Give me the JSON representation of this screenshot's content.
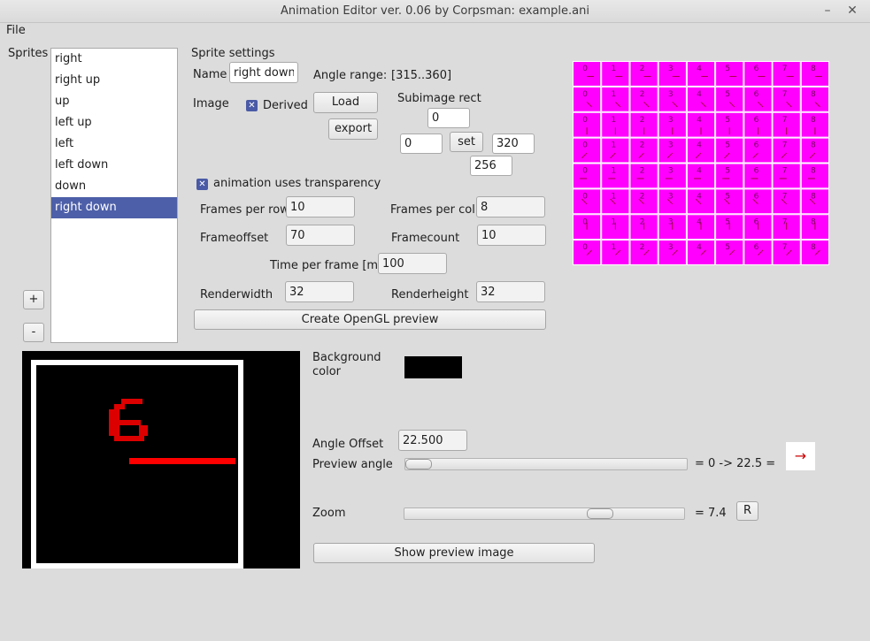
{
  "window": {
    "title": "Animation Editor ver. 0.06 by Corpsman: example.ani",
    "minimize": "–",
    "close": "✕"
  },
  "menu": {
    "file": "File"
  },
  "sprites": {
    "label": "Sprites",
    "items": [
      "right",
      "right up",
      "up",
      "left up",
      "left",
      "left down",
      "down",
      "right down"
    ],
    "selected_index": 7,
    "add_label": "+",
    "remove_label": "-"
  },
  "settings": {
    "heading": "Sprite settings",
    "name_label": "Name",
    "name_value": "right down",
    "angle_range_label": "Angle range:",
    "angle_range_value": "[315..360]",
    "image_label": "Image",
    "derived_label": "Derived",
    "derived_checked": true,
    "load_label": "Load",
    "export_label": "export",
    "subimage_label": "Subimage rect",
    "sub_top": "0",
    "sub_left": "0",
    "sub_set": "set",
    "sub_right": "320",
    "sub_bottom": "256",
    "transparency_label": "animation uses transparency",
    "transparency_checked": true,
    "frames_per_row_label": "Frames per row",
    "frames_per_row": "10",
    "frames_per_col_label": "Frames per col",
    "frames_per_col": "8",
    "frameoffset_label": "Frameoffset",
    "frameoffset": "70",
    "framecount_label": "Framecount",
    "framecount": "10",
    "time_per_frame_label": "Time per frame [ms]",
    "time_per_frame": "100",
    "renderwidth_label": "Renderwidth",
    "renderwidth": "32",
    "renderheight_label": "Renderheight",
    "renderheight": "32",
    "create_preview_label": "Create OpenGL preview"
  },
  "sheet": {
    "rows": 8,
    "cols": 9,
    "digits": [
      "0",
      "1",
      "2",
      "3",
      "4",
      "5",
      "6",
      "7",
      "8",
      "9"
    ],
    "color": "#ff00ff"
  },
  "preview": {
    "digit": "6",
    "background_label": "Background color",
    "background_color": "#000000",
    "angle_offset_label": "Angle Offset",
    "angle_offset": "22.500",
    "preview_angle_label": "Preview angle",
    "preview_angle_readout": "= 0 -> 22.5 =",
    "preview_angle_fraction": 0.0,
    "zoom_label": "Zoom",
    "zoom_readout": "= 7.4",
    "zoom_fraction": 0.72,
    "reset_label": "R",
    "show_preview_label": "Show preview image",
    "arrow_glyph": "→"
  }
}
